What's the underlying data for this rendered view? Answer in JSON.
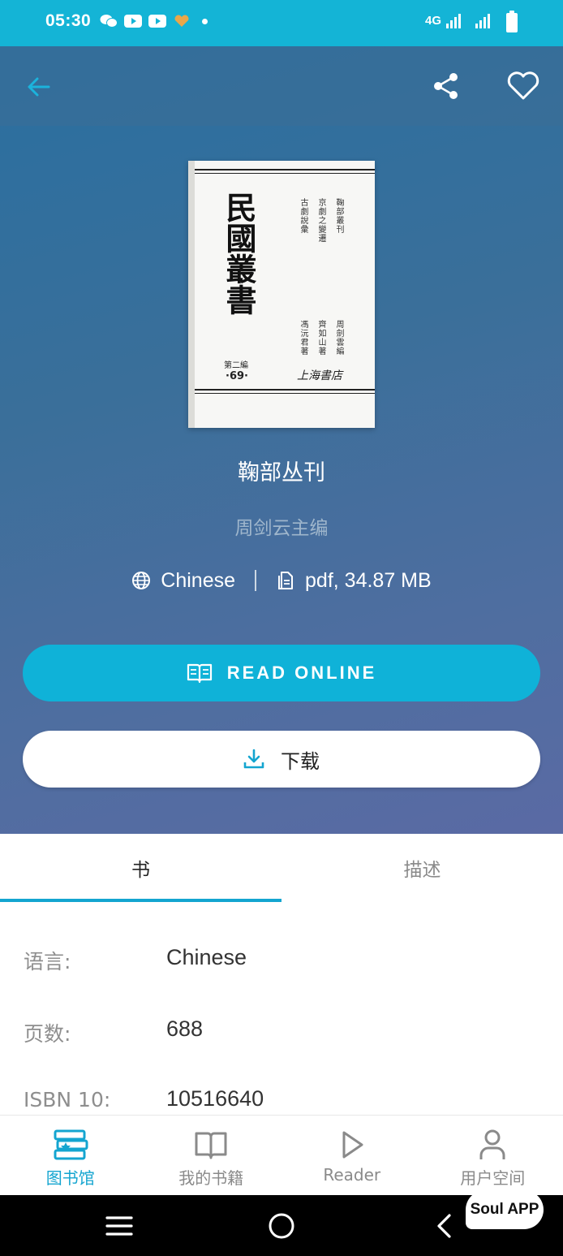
{
  "status_bar": {
    "time": "05:30",
    "network": "4G",
    "icons": [
      "wechat-icon",
      "youtube-icon",
      "youtube-icon",
      "heart-app-icon",
      "dot-icon",
      "signal-icon",
      "signal-icon",
      "battery-icon"
    ]
  },
  "toolbar": {
    "back_icon": "arrow-left-icon",
    "share_icon": "share-icon",
    "favorite_icon": "heart-outline-icon",
    "accent": "#14b4d6"
  },
  "cover": {
    "main_title": "民國叢書",
    "series": "第二編",
    "series_number": "·69·",
    "col_1": "鞠部叢刊",
    "col_2": "京劇之變遷",
    "col_3": "古劇說彙",
    "col_4": "周劍雲編",
    "col_5": "齊如山著",
    "col_6": "馮沅君著",
    "publisher": "上海書店"
  },
  "book": {
    "title": "鞠部丛刊",
    "author": "周剑云主编",
    "language": "Chinese",
    "file_info": "pdf, 34.87 MB"
  },
  "actions": {
    "read_online": "READ ONLINE",
    "download": "下载"
  },
  "tabs": [
    {
      "label": "书",
      "active": true
    },
    {
      "label": "描述",
      "active": false
    }
  ],
  "details": [
    {
      "key": "语言:",
      "value": "Chinese"
    },
    {
      "key": "页数:",
      "value": "688"
    },
    {
      "key": "ISBN 10:",
      "value": "10516640"
    }
  ],
  "bottom_nav": [
    {
      "label": "图书馆",
      "icon": "library-icon",
      "active": true
    },
    {
      "label": "我的书籍",
      "icon": "open-book-icon",
      "active": false
    },
    {
      "label": "Reader",
      "icon": "play-icon",
      "active": false
    },
    {
      "label": "用户空间",
      "icon": "user-icon",
      "active": false
    }
  ],
  "system_nav": {
    "watermark": "Soul APP"
  }
}
